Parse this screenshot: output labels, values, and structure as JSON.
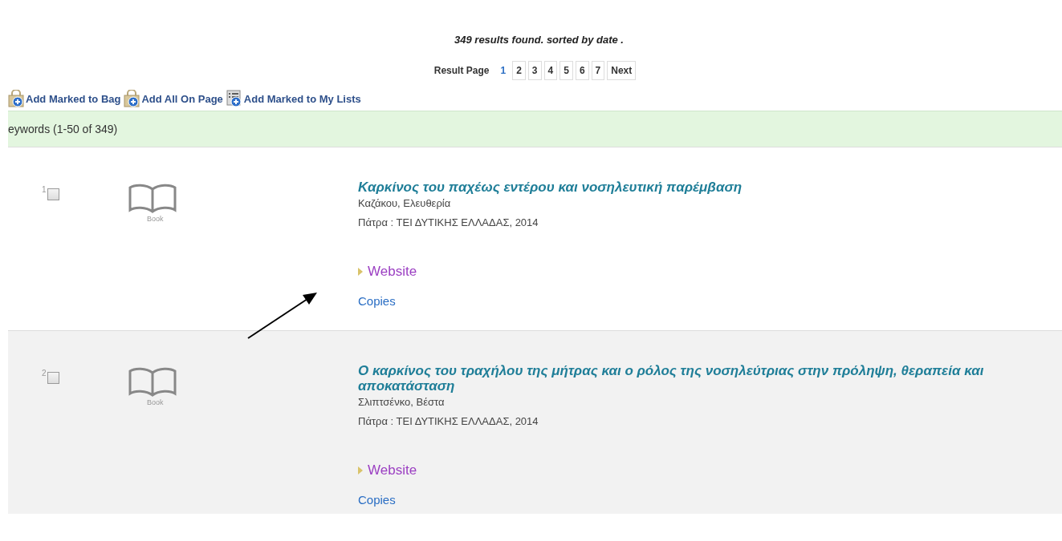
{
  "summary": "349 results found. sorted by date .",
  "pagination": {
    "label": "Result Page",
    "pages": [
      {
        "label": "1",
        "selected": true
      },
      {
        "label": "2",
        "selected": false
      },
      {
        "label": "3",
        "selected": false
      },
      {
        "label": "4",
        "selected": false
      },
      {
        "label": "5",
        "selected": false
      },
      {
        "label": "6",
        "selected": false
      },
      {
        "label": "7",
        "selected": false
      }
    ],
    "next": "Next"
  },
  "toolbar": [
    {
      "kind": "bag",
      "label": "Add Marked to Bag"
    },
    {
      "kind": "bag",
      "label": "Add All On Page"
    },
    {
      "kind": "list",
      "label": "Add Marked to My Lists"
    }
  ],
  "results_header": "eywords (1-50 of 349)",
  "results": [
    {
      "number": "1",
      "checked": false,
      "format": "Book",
      "title": "Καρκίνος του παχέως εντέρου και νοσηλευτική παρέμβαση",
      "author": "Καζάκου, Ελευθερία",
      "publication": "Πάτρα : ΤΕΙ ΔΥΤΙΚΗΣ ΕΛΛΑΔΑΣ, 2014",
      "website": "Website",
      "copies": "Copies"
    },
    {
      "number": "2",
      "checked": false,
      "format": "Book",
      "title": "Ο καρκίνος του τραχήλου της μήτρας και ο ρόλος της νοσηλεύτριας στην πρόληψη, θεραπεία και αποκατάσταση",
      "author": "Σλιπτσένκο, Βέστα",
      "publication": "Πάτρα : ΤΕΙ ΔΥΤΙΚΗΣ ΕΛΛΑΔΑΣ, 2014",
      "website": "Website",
      "copies": "Copies"
    }
  ]
}
